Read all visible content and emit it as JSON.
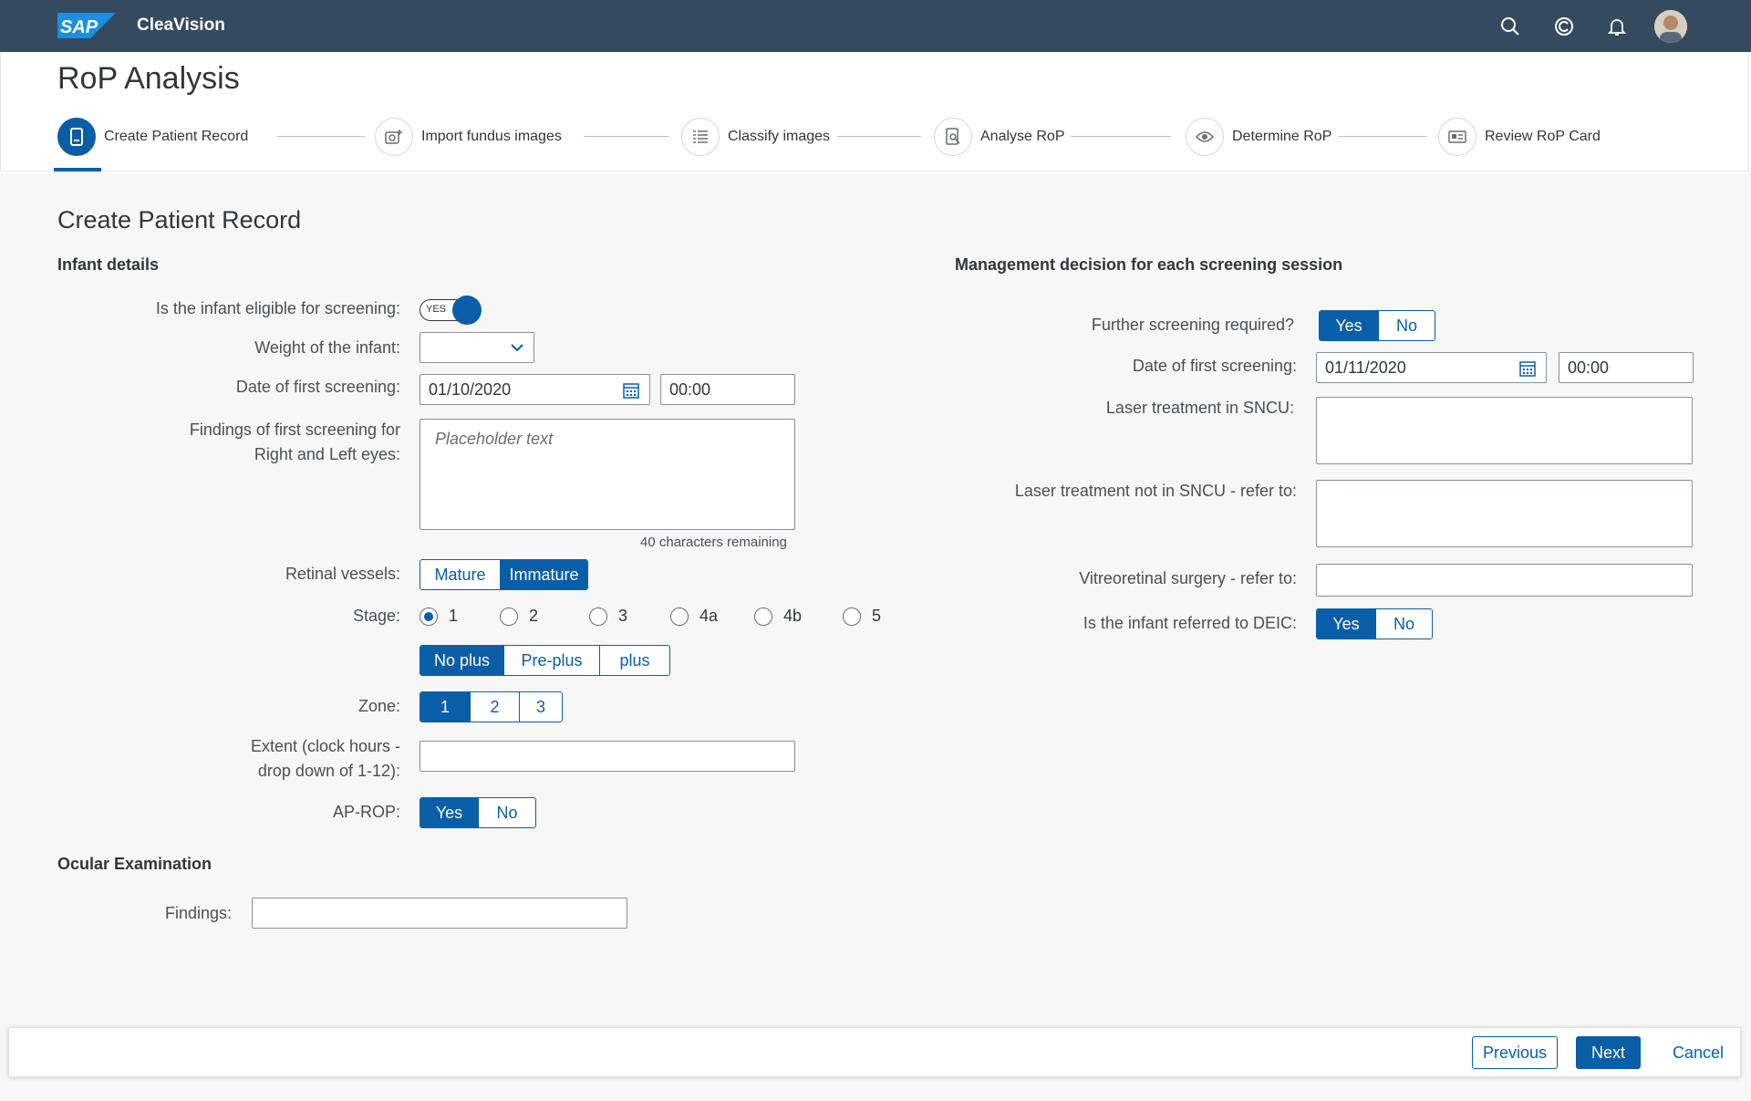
{
  "shell": {
    "logo_text": "SAP",
    "app_title": "CleaVision",
    "icons": [
      "search-icon",
      "copilot-icon",
      "notification-bell-icon",
      "user-avatar"
    ]
  },
  "page": {
    "title": "RoP Analysis"
  },
  "wizard": {
    "steps": [
      {
        "label": "Create Patient Record",
        "icon": "document-icon",
        "active": true
      },
      {
        "label": "Import fundus images",
        "icon": "add-photo-icon",
        "active": false
      },
      {
        "label": "Classify images",
        "icon": "list-icon",
        "active": false
      },
      {
        "label": "Analyse RoP",
        "icon": "inspect-icon",
        "active": false
      },
      {
        "label": "Determine RoP",
        "icon": "eye-icon",
        "active": false
      },
      {
        "label": "Review RoP Card",
        "icon": "id-card-icon",
        "active": false
      }
    ]
  },
  "form": {
    "section_title": "Create Patient Record",
    "infant": {
      "title": "Infant details",
      "eligible_label": "Is the infant eligible for screening:",
      "eligible_switch_text": "YES",
      "weight_label": "Weight of the infant:",
      "weight_value": "",
      "date_label": "Date of first screening:",
      "date_value": "01/10/2020",
      "time_value": "00:00",
      "findings_label_1": "Findings of first screening for",
      "findings_label_2": "Right and Left eyes:",
      "findings_placeholder": "Placeholder text",
      "findings_counter": "40 characters remaining",
      "vessels_label": "Retinal vessels:",
      "vessels_options": [
        "Mature",
        "Immature"
      ],
      "vessels_selected": "Immature",
      "stage_label": "Stage:",
      "stage_options": [
        "1",
        "2",
        "3",
        "4a",
        "4b",
        "5"
      ],
      "stage_selected": "1",
      "plus_options": [
        "No plus",
        "Pre-plus",
        "plus"
      ],
      "plus_selected": "No plus",
      "zone_label": "Zone:",
      "zone_options": [
        "1",
        "2",
        "3"
      ],
      "zone_selected": "1",
      "extent_label_1": "Extent (clock hours -",
      "extent_label_2": "drop down of 1-12):",
      "extent_value": "",
      "aprop_label": "AP-ROP:",
      "aprop_options": [
        "Yes",
        "No"
      ],
      "aprop_selected": "Yes"
    },
    "ocular": {
      "title": "Ocular Examination",
      "findings_label": "Findings:",
      "findings_value": ""
    },
    "management": {
      "title": "Management decision for each screening session",
      "further_label": "Further screening required?",
      "further_options": [
        "Yes",
        "No"
      ],
      "further_selected": "Yes",
      "date_label": "Date of first screening:",
      "date_value": "01/11/2020",
      "time_value": "00:00",
      "laser_sncu_label": "Laser treatment in SNCU:",
      "laser_not_sncu_label": "Laser treatment not in SNCU - refer to:",
      "vitreo_label": "Vitreoretinal surgery - refer to:",
      "deic_label": "Is the infant referred to DEIC:",
      "deic_options": [
        "Yes",
        "No"
      ],
      "deic_selected": "Yes"
    }
  },
  "footer": {
    "previous": "Previous",
    "next": "Next",
    "cancel": "Cancel"
  },
  "colors": {
    "shell": "#354a5f",
    "accent": "#0a5ea8",
    "background": "#f7f7f7"
  }
}
